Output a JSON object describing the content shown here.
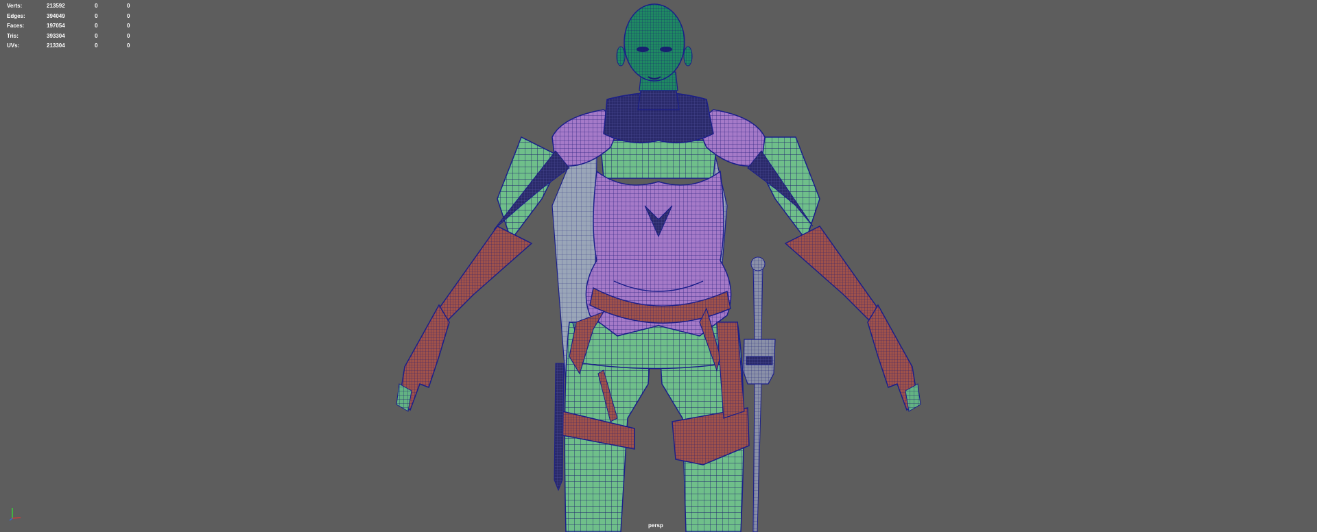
{
  "viewport": {
    "background": "#5d5d5d",
    "camera": "persp"
  },
  "heads_up_display": {
    "rows": [
      {
        "label": "Verts:",
        "total": "213592",
        "selected": "0",
        "component": "0"
      },
      {
        "label": "Edges:",
        "total": "394049",
        "selected": "0",
        "component": "0"
      },
      {
        "label": "Faces:",
        "total": "197054",
        "selected": "0",
        "component": "0"
      },
      {
        "label": "Tris:",
        "total": "393304",
        "selected": "0",
        "component": "0"
      },
      {
        "label": "UVs:",
        "total": "213304",
        "selected": "0",
        "component": "0"
      }
    ]
  },
  "axis_gizmo": {
    "x_color": "#d03a3a",
    "y_color": "#3ad03a",
    "z_color": "#3a6ad0"
  },
  "model": {
    "skin_color": "#6fbf8a",
    "wire_color": "#1a1e8a",
    "armor_color": "#a57ac8",
    "leather_color": "#a0524a",
    "head_color": "#1f8a62",
    "cape_color": "#9aa6b8"
  }
}
